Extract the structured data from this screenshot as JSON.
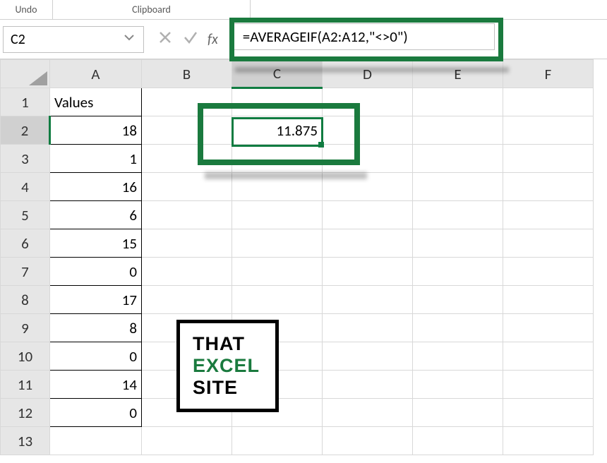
{
  "ribbon": {
    "undo_label": "Undo",
    "clipboard_label": "Clipboard"
  },
  "name_box": {
    "value": "C2"
  },
  "formula_bar": {
    "fx_label": "fx",
    "formula": "=AVERAGEIF(A2:A12,\"<>0\")"
  },
  "columns": [
    "A",
    "B",
    "C",
    "D",
    "E",
    "F"
  ],
  "rows": [
    "1",
    "2",
    "3",
    "4",
    "5",
    "6",
    "7",
    "8",
    "9",
    "10",
    "11",
    "12",
    "13"
  ],
  "sheet": {
    "a1": "Values",
    "a2": "18",
    "a3": "1",
    "a4": "16",
    "a5": "6",
    "a6": "15",
    "a7": "0",
    "a8": "17",
    "a9": "8",
    "a10": "0",
    "a11": "14",
    "a12": "0",
    "c2": "11.875"
  },
  "logo": {
    "line1": "THAT",
    "line2": "EXCEL",
    "line3": "SITE"
  },
  "active_cell": "C2",
  "highlight_color": "#1a7a3e"
}
